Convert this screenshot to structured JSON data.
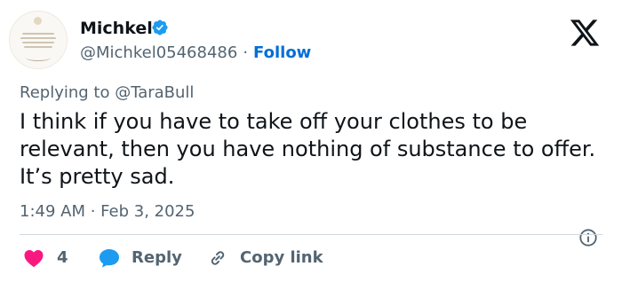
{
  "author": {
    "display_name": "Michkel",
    "handle": "@Michkel05468486",
    "separator": "·",
    "follow_label": "Follow",
    "verified": true,
    "verified_color": "#1d9bf0",
    "avatar_icon": "quote-card-avatar"
  },
  "brand_icon": "x-logo-icon",
  "reply_to": "Replying to @TaraBull",
  "tweet": {
    "text": "I think if you have to take off your clothes to be relevant, then you have nothing of substance to offer. It’s pretty sad."
  },
  "meta": {
    "timestamp": "1:49 AM · Feb 3, 2025",
    "info_icon": "info-icon"
  },
  "actions": {
    "like_count": "4",
    "like_color": "#f91880",
    "reply_label": "Reply",
    "reply_color": "#1d9bf0",
    "copy_label": "Copy link"
  },
  "colors": {
    "text": "#0f1419",
    "secondary": "#536471",
    "link": "#006fd6",
    "divider": "#cfd9de"
  }
}
